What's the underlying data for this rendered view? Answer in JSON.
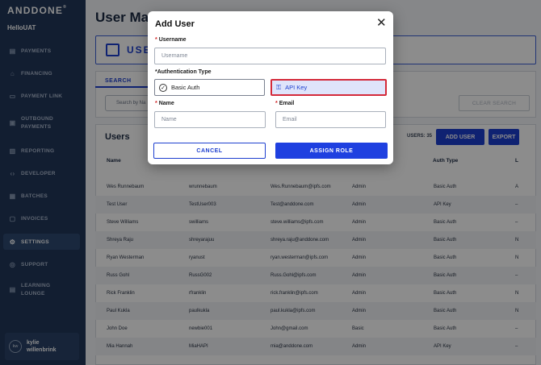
{
  "brand": {
    "logo": "ANDDONE",
    "environment": "HelloUAT"
  },
  "sidebar": {
    "items": [
      {
        "label": "PAYMENTS",
        "icon": "payments-icon"
      },
      {
        "label": "FINANCING",
        "icon": "financing-icon"
      },
      {
        "label": "PAYMENT LINK",
        "icon": "link-icon"
      },
      {
        "label": "OUTBOUND PAYMENTS",
        "icon": "outbound-icon"
      },
      {
        "label": "REPORTING",
        "icon": "reporting-icon"
      },
      {
        "label": "DEVELOPER",
        "icon": "code-icon"
      },
      {
        "label": "BATCHES",
        "icon": "batches-icon"
      },
      {
        "label": "INVOICES",
        "icon": "invoice-icon"
      },
      {
        "label": "SETTINGS",
        "icon": "gear-icon",
        "active": true
      },
      {
        "label": "SUPPORT",
        "icon": "support-icon"
      },
      {
        "label": "LEARNING LOUNGE",
        "icon": "learning-icon"
      }
    ],
    "user": {
      "initials": "kw",
      "name_line1": "kylie",
      "name_line2": "willenbrink"
    }
  },
  "main": {
    "title": "User Man",
    "card_label": "USEI",
    "search_tab": "SEARCH",
    "search_placeholder": "Search by Na",
    "clear_search": "CLEAR SEARCH",
    "users_title": "Users",
    "users_count": "USERS: 35",
    "add_user": "ADD USER",
    "export": "EXPORT",
    "columns": [
      "Name",
      "Auth Type",
      "L"
    ],
    "rows": [
      {
        "name": "Wes Runnebaum",
        "username": "wrunnebaum",
        "email": "Wes.Runnebaum@ipfs.com",
        "role": "Admin",
        "auth": "Basic Auth",
        "last": "A"
      },
      {
        "name": "Test User",
        "username": "TestUser003",
        "email": "Test@anddone.com",
        "role": "Admin",
        "auth": "API Key",
        "last": "–"
      },
      {
        "name": "Steve Williams",
        "username": "swilliams",
        "email": "steve.williams@ipfs.com",
        "role": "Admin",
        "auth": "Basic Auth",
        "last": "–"
      },
      {
        "name": "Shreya Raju",
        "username": "shreyarajuu",
        "email": "shreya.raju@anddone.com",
        "role": "Admin",
        "auth": "Basic Auth",
        "last": "N"
      },
      {
        "name": "Ryan Westerman",
        "username": "ryanust",
        "email": "ryan.westerman@ipfs.com",
        "role": "Admin",
        "auth": "Basic Auth",
        "last": "N"
      },
      {
        "name": "Russ Gohl",
        "username": "RussG002",
        "email": "Russ.Gohl@ipfs.com",
        "role": "Admin",
        "auth": "Basic Auth",
        "last": "–"
      },
      {
        "name": "Rick Franklin",
        "username": "rfranklin",
        "email": "rick.franklin@ipfs.com",
        "role": "Admin",
        "auth": "Basic Auth",
        "last": "N"
      },
      {
        "name": "Paul Kukla",
        "username": "paulkukla",
        "email": "paul.kukla@ipfs.com",
        "role": "Admin",
        "auth": "Basic Auth",
        "last": "N"
      },
      {
        "name": "John Doe",
        "username": "newbie001",
        "email": "John@gmail.com",
        "role": "Basic",
        "auth": "Basic Auth",
        "last": "–"
      },
      {
        "name": "Mia Hannah",
        "username": "MiaHAPI",
        "email": "mia@anddone.com",
        "role": "Admin",
        "auth": "API Key",
        "last": "–"
      }
    ]
  },
  "modal": {
    "title": "Add User",
    "username_label": "Username",
    "username_placeholder": "Username",
    "auth_label": "*Authentication Type",
    "auth_basic": "Basic Auth",
    "auth_api": "API Key",
    "name_label": "Name",
    "name_placeholder": "Name",
    "email_label": "Email",
    "email_placeholder": "Email",
    "cancel": "CANCEL",
    "assign": "ASSIGN ROLE",
    "required_mark": "*"
  },
  "colors": {
    "accent": "#1d3fcf",
    "sidebar": "#21375a",
    "selected_border": "#d42a3a",
    "selected_bg": "#dfe4fb"
  }
}
